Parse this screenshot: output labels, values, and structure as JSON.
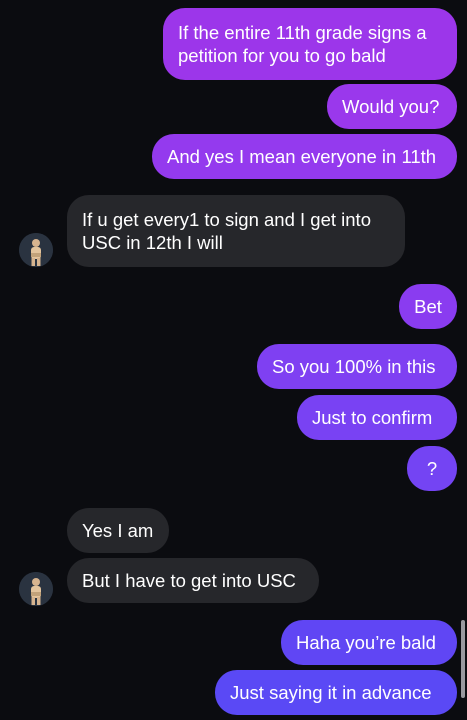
{
  "colors": {
    "background": "#0b0c10",
    "incoming_bubble": "#26272b",
    "outgoing_top": "#a134e8",
    "outgoing_mid": "#8a3cf0",
    "outgoing_bottom": "#5b49f5",
    "text": "#ffffff"
  },
  "messages": [
    {
      "from": "me",
      "lines": [
        "If the entire 11th grade signs a",
        "petition for you to go bald"
      ]
    },
    {
      "from": "me",
      "text": "Would you?"
    },
    {
      "from": "me",
      "text": "And yes I mean everyone in 11th"
    },
    {
      "from": "them",
      "lines": [
        "If u get every1 to sign and I get into",
        "USC in 12th I will"
      ]
    },
    {
      "from": "me",
      "text": "Bet"
    },
    {
      "from": "me",
      "text": "So you 100% in this"
    },
    {
      "from": "me",
      "text": "Just to confirm"
    },
    {
      "from": "me",
      "text": "?"
    },
    {
      "from": "them",
      "text": "Yes I am"
    },
    {
      "from": "them",
      "text": "But I have to get into USC"
    },
    {
      "from": "me",
      "text": "Haha you’re bald"
    },
    {
      "from": "me",
      "text": "Just saying it in advance"
    }
  ],
  "icons": {
    "contact_avatar": "contact-avatar-icon"
  }
}
